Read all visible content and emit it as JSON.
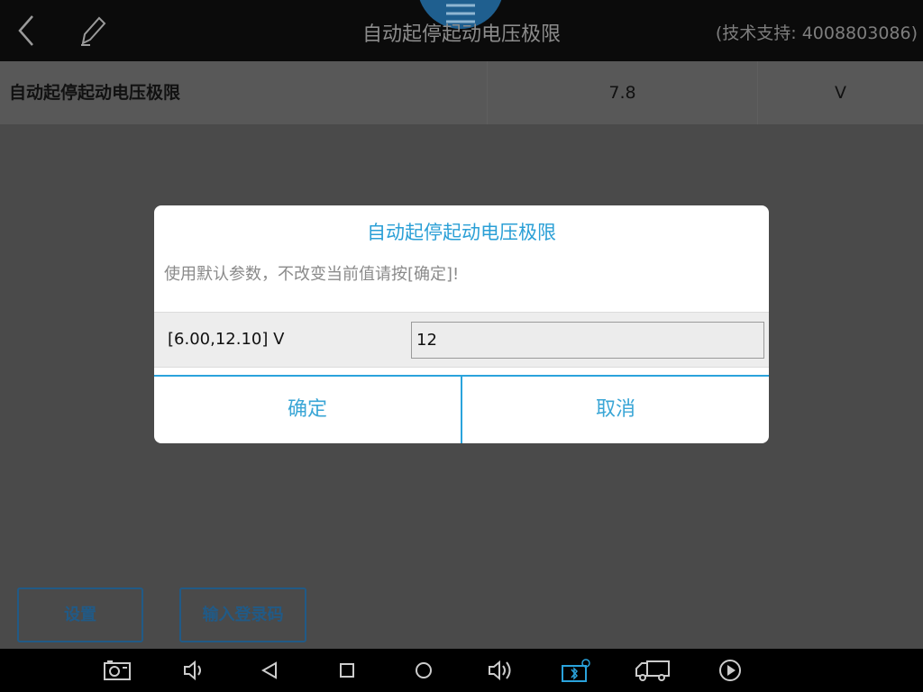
{
  "titlebar": {
    "title": "自动起停起动电压极限",
    "support": "(技术支持: 4008803086)"
  },
  "row": {
    "name": "自动起停起动电压极限",
    "value": "7.8",
    "unit": "V"
  },
  "dialog": {
    "title": "自动起停起动电压极限",
    "message": "使用默认参数，不改变当前值请按[确定]!",
    "range": "[6.00,12.10] V",
    "input_value": "12",
    "ok_label": "确定",
    "cancel_label": "取消"
  },
  "bottom": {
    "settings_label": "设置",
    "login_label": "输入登录码"
  },
  "colors": {
    "accent": "#2aa3dc",
    "titlebar_bg": "#0b0b0b",
    "overlay_bg": "#4a4a4a",
    "button_border": "#215a86"
  },
  "icons": {
    "back": "back-chevron-icon",
    "edit": "pencil-icon",
    "menu": "hamburger-menu-icon",
    "screenshot": "camera-screenshot-icon",
    "volume_down": "volume-down-icon",
    "nav_back": "triangle-back-icon",
    "nav_home": "circle-home-icon",
    "nav_recent": "square-recent-icon",
    "volume_up": "volume-up-icon",
    "bluetooth": "bluetooth-vci-icon",
    "truck": "truck-icon",
    "play": "play-circle-icon"
  }
}
